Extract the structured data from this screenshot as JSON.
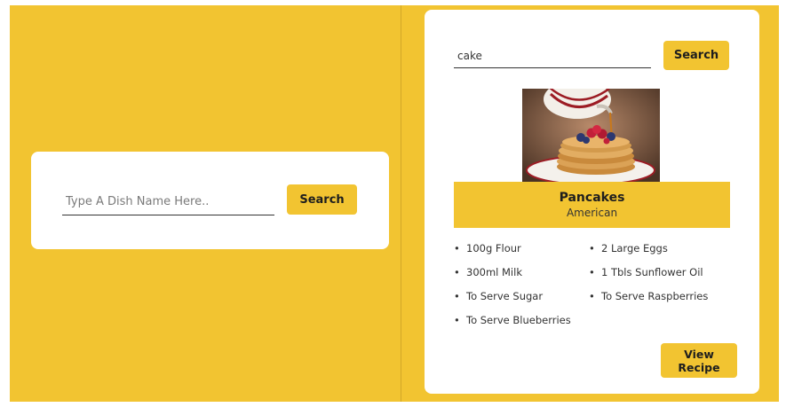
{
  "colors": {
    "accent": "#f2c431",
    "card": "#ffffff",
    "text": "#1e1e1e"
  },
  "left_search": {
    "placeholder": "Type A Dish Name Here..",
    "value": "",
    "button_label": "Search"
  },
  "right_search": {
    "value": "cake",
    "button_label": "Search"
  },
  "recipe": {
    "image_icon": "pancakes-image",
    "title": "Pancakes",
    "cuisine": "American",
    "ingredients": [
      "100g Flour",
      "2 Large Eggs",
      "300ml Milk",
      "1 Tbls Sunflower Oil",
      "To Serve Sugar",
      "To Serve Raspberries",
      "To Serve Blueberries"
    ],
    "view_button_label": "View Recipe"
  }
}
